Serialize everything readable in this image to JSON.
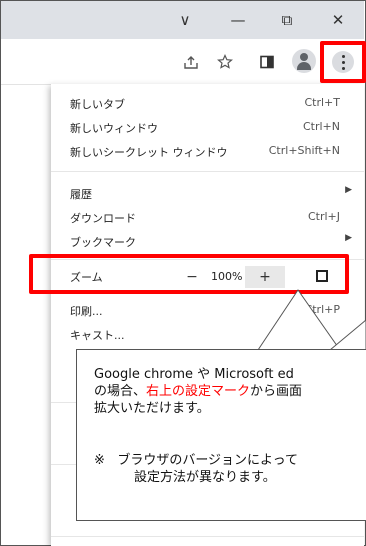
{
  "titlebar": {
    "buttons": [
      {
        "name": "tab-search-icon",
        "glyph": "∨"
      },
      {
        "name": "minimize-icon",
        "glyph": "—"
      },
      {
        "name": "restore-icon",
        "glyph": "⧉"
      },
      {
        "name": "close-icon",
        "glyph": "✕"
      }
    ]
  },
  "toolbar": {
    "icons": [
      "share-icon",
      "bookmark-star-icon",
      "side-panel-icon",
      "profile-avatar-icon",
      "more-menu-icon"
    ]
  },
  "menu": {
    "items": [
      {
        "label": "新しいタブ",
        "shortcut": "Ctrl+T"
      },
      {
        "label": "新しいウィンドウ",
        "shortcut": "Ctrl+N"
      },
      {
        "label": "新しいシークレット ウィンドウ",
        "shortcut": "Ctrl+Shift+N"
      },
      {
        "label": "履歴",
        "shortcut": ""
      },
      {
        "label": "ダウンロード",
        "shortcut": "Ctrl+J"
      },
      {
        "label": "ブックマーク",
        "shortcut": ""
      },
      {
        "label": "印刷...",
        "shortcut": "Ctrl+P"
      },
      {
        "label": "キャスト...",
        "shortcut": ""
      }
    ],
    "zoom": {
      "label": "ズーム",
      "minus": "−",
      "value": "100%",
      "plus": "+"
    }
  },
  "callout": {
    "line1": "Google chrome や Microsoft ed",
    "line2_pre": "の場合、",
    "line2_red": "右上の設定マーク",
    "line2_post": "から画面",
    "line3": "拡大いただけます。",
    "note_mark": "※",
    "note1": "ブラウザのバージョンによって",
    "note2": "設定方法が異なります。"
  },
  "colors": {
    "highlight": "#ff0000",
    "titlebar": "#dee1e6"
  }
}
